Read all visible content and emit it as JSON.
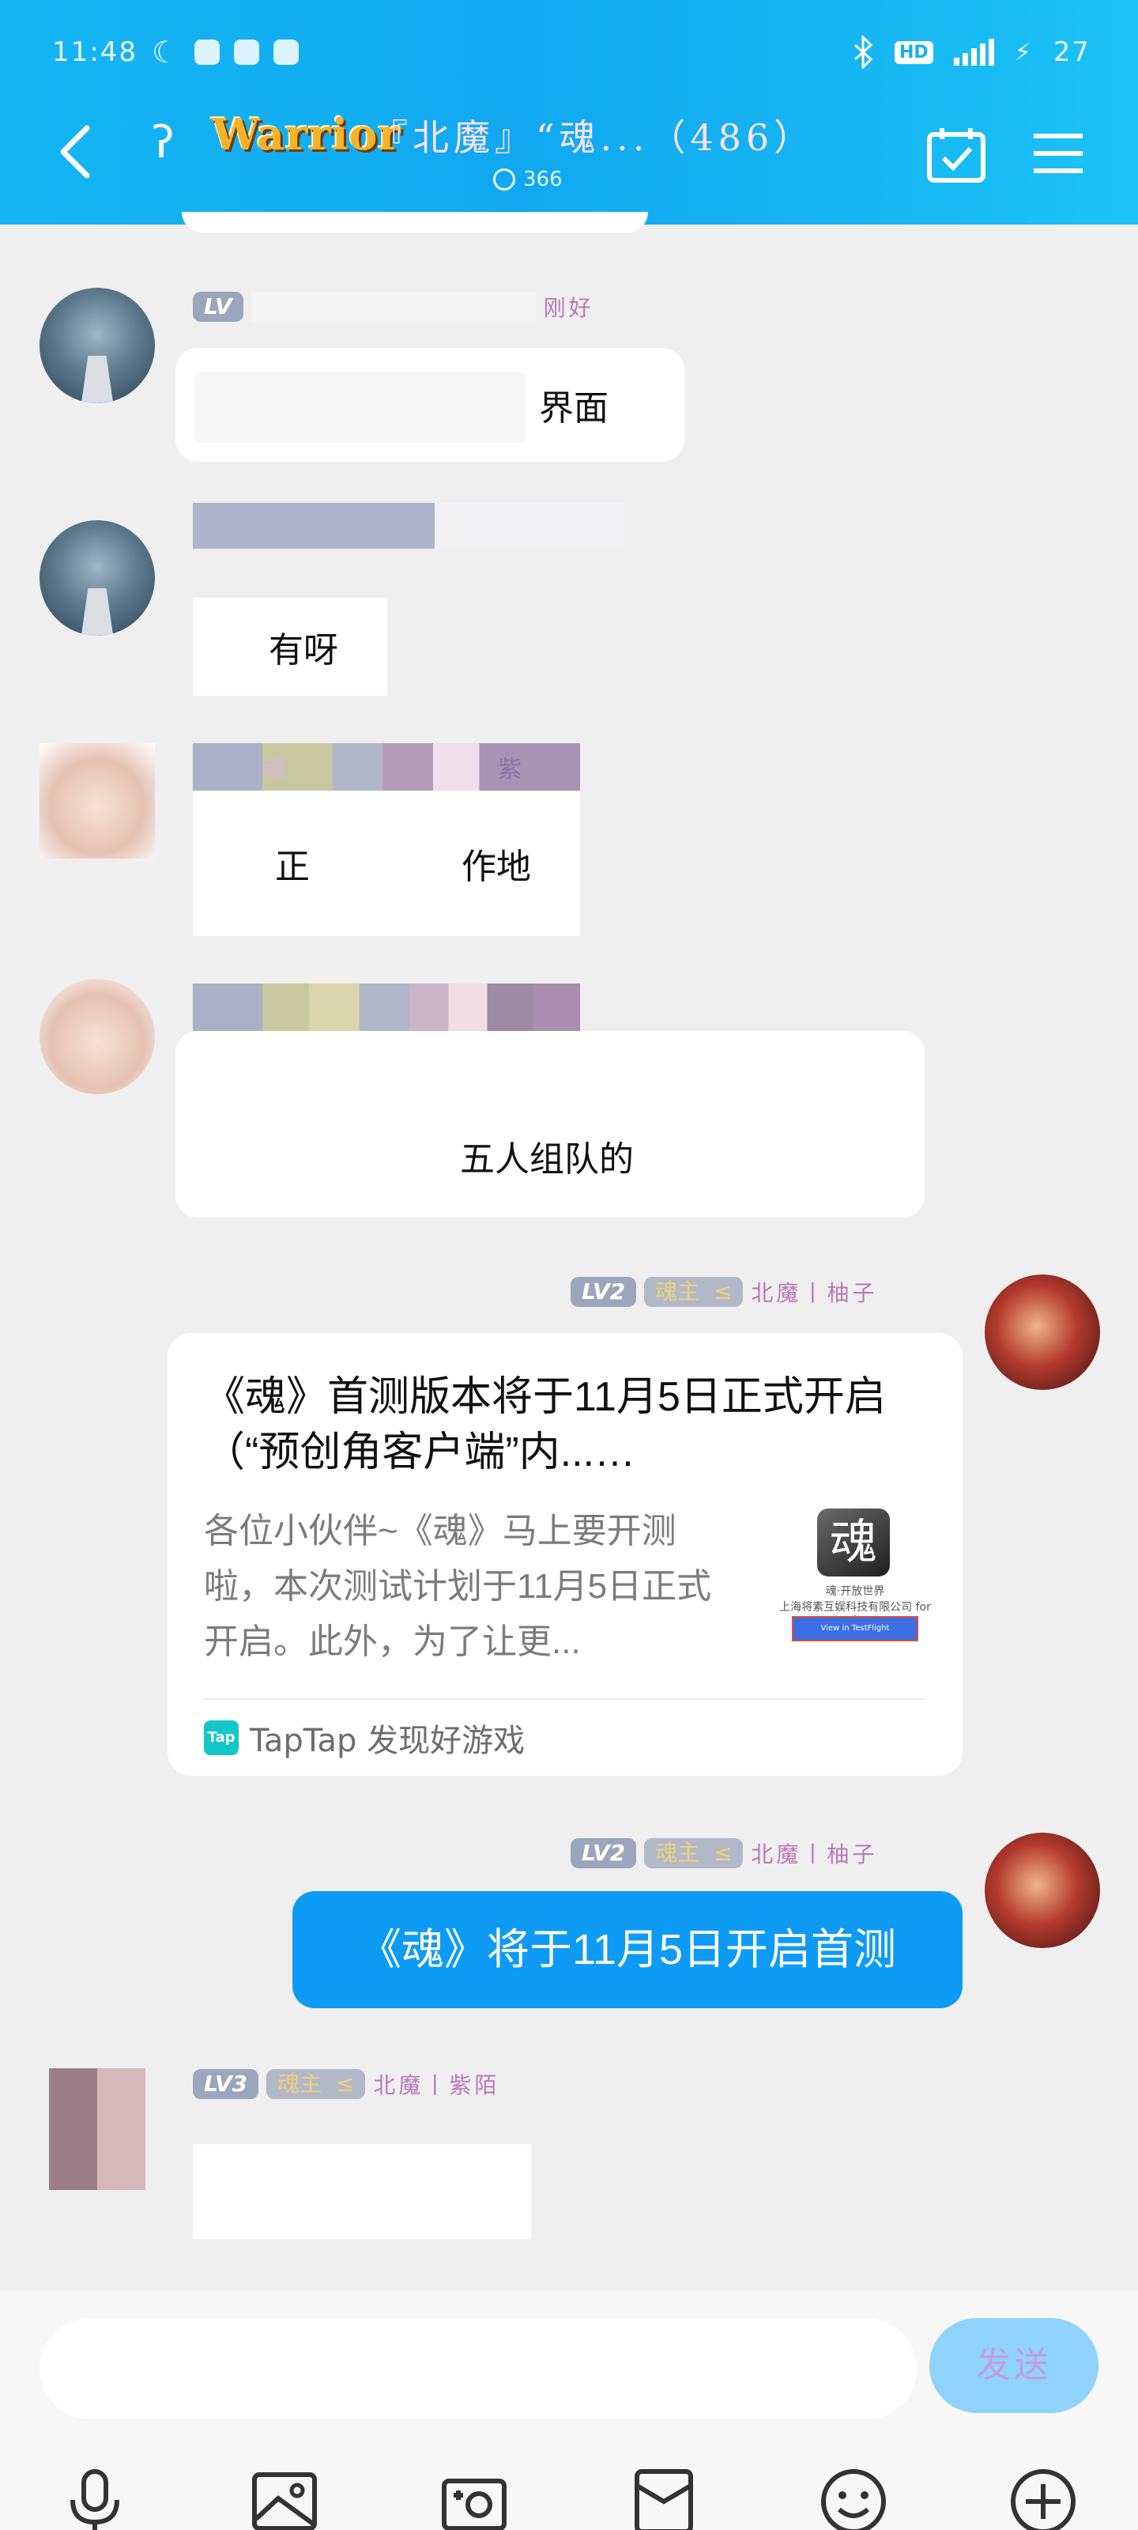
{
  "status_bar": {
    "time": "11:48",
    "battery": "27"
  },
  "header": {
    "group_logo_text": "Warrior",
    "group_name": "『北魔』“魂...（486）",
    "online_count": "366"
  },
  "messages": [
    {
      "sender_level": "LV",
      "sender_name": "刚好",
      "text": "界面"
    },
    {
      "text": "有呀"
    },
    {
      "sender_tag": "魂",
      "sender_name": "紫",
      "text_parts": [
        "正",
        "作地"
      ]
    },
    {
      "text": "五人组队的"
    },
    {
      "sender_level": "LV2",
      "sender_tag": "魂主",
      "sender_name": "北魔丨柚子",
      "card": {
        "title": "《魂》首测版本将于11月5日正式开启（“预创角客户端”内...…",
        "description": "各位小伙伴~《魂》马上要开测啦，本次测试计划于11月5日正式开启。此外，为了让更...",
        "thumb_logo": "魂",
        "thumb_line_1": "魂·开放世界",
        "thumb_line_2": "上海将素互娱科技有限公司 for i",
        "thumb_button": "View in TestFlight",
        "source_logo": "Tap",
        "source": "TapTap 发现好游戏"
      }
    },
    {
      "sender_level": "LV2",
      "sender_tag": "魂主",
      "sender_name": "北魔丨柚子",
      "text": "《魂》将于11月5日开启首测"
    },
    {
      "sender_level": "LV3",
      "sender_tag": "魂主",
      "sender_name": "北魔丨紫陌",
      "text": ""
    }
  ],
  "composer": {
    "input_value": "",
    "send_label": "发送"
  },
  "colors": {
    "header": "#15b6f4",
    "own_bubble": "#0d9bf5",
    "send_button": "#8fd2fb",
    "background": "#efefef"
  },
  "icons": [
    "back-icon",
    "ear-icon",
    "calendar-check-icon",
    "menu-icon",
    "microphone-icon",
    "image-icon",
    "camera-icon",
    "red-packet-icon",
    "emoji-icon",
    "plus-icon"
  ]
}
